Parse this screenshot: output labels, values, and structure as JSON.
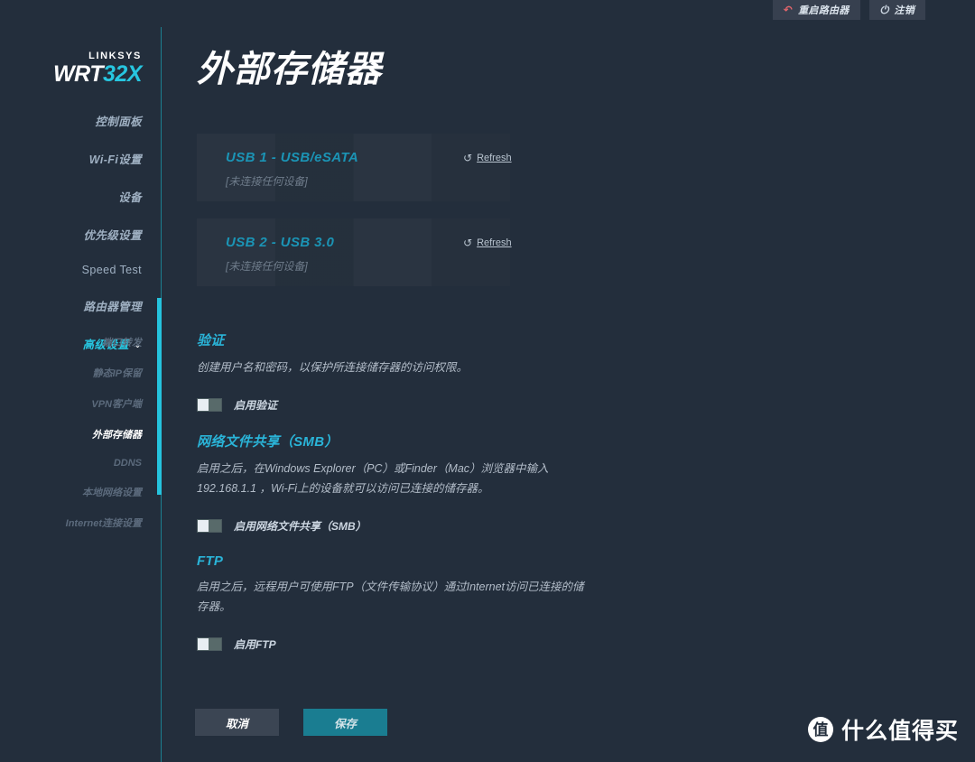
{
  "topbar": {
    "reboot_label": "重启路由器",
    "reboot_icon": "refresh-ccw-icon",
    "logout_label": "注销",
    "logout_icon": "power-icon"
  },
  "sidebar": {
    "brand_top": "LINKSYS",
    "brand_wrt": "WRT",
    "brand_model": "32X",
    "items": [
      {
        "label": "控制面板",
        "style": "italic",
        "active": false
      },
      {
        "label": "Wi-Fi设置",
        "style": "italic",
        "active": false
      },
      {
        "label": "设备",
        "style": "italic",
        "active": false
      },
      {
        "label": "优先级设置",
        "style": "italic",
        "active": false
      },
      {
        "label": "Speed Test",
        "style": "roman",
        "active": false
      },
      {
        "label": "路由器管理",
        "style": "italic",
        "active": false
      },
      {
        "label": "高级设置",
        "style": "italic",
        "active": true,
        "chevron": "⌄"
      }
    ],
    "subitems": [
      {
        "label": "端口转发",
        "active": false
      },
      {
        "label": "静态IP保留",
        "active": false
      },
      {
        "label": "VPN客户端",
        "active": false
      },
      {
        "label": "外部存储器",
        "active": true
      },
      {
        "label": "DDNS",
        "active": false
      },
      {
        "label": "本地网络设置",
        "active": false
      },
      {
        "label": "Internet连接设置",
        "active": false
      }
    ]
  },
  "main": {
    "title": "外部存储器",
    "usb_ports": [
      {
        "title": "USB 1 - USB/eSATA",
        "status": "[未连接任何设备]",
        "refresh_label": "Refresh",
        "refresh_icon": "refresh-icon"
      },
      {
        "title": "USB 2 - USB 3.0",
        "status": "[未连接任何设备]",
        "refresh_label": "Refresh",
        "refresh_icon": "refresh-icon"
      }
    ],
    "auth": {
      "heading": "验证",
      "description": "创建用户名和密码，以保护所连接储存器的访问权限。",
      "toggle_label": "启用验证",
      "toggle_state": "off"
    },
    "smb": {
      "heading": "网络文件共享（SMB）",
      "description": "启用之后，在Windows Explorer（PC）或Finder（Mac）浏览器中输入 192.168.1.1 ，Wi-Fi上的设备就可以访问已连接的储存器。",
      "toggle_label": "启用网络文件共享（SMB）",
      "toggle_state": "off"
    },
    "ftp": {
      "heading": "FTP",
      "description": "启用之后，远程用户可使用FTP（文件传输协议）通过Internet访问已连接的储存器。",
      "toggle_label": "启用FTP",
      "toggle_state": "off"
    },
    "cancel_label": "取消",
    "save_label": "保存"
  },
  "watermark": {
    "badge": "值",
    "text": "什么值得买"
  },
  "colors": {
    "background": "#232e3c",
    "panel": "#27323f",
    "accent_cyan": "#27c6e0",
    "heading_cyan": "#2ab4d8",
    "save_teal": "#1a7d91",
    "reboot_red": "#e2656b"
  }
}
